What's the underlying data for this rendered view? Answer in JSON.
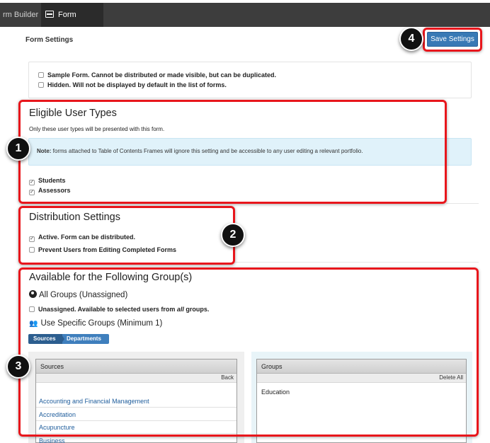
{
  "header": {
    "tab_builder": "rm Builder",
    "tab_settings": "Form Settings"
  },
  "page": {
    "title": "Form Settings",
    "save_label": "Save Settings"
  },
  "form_options": {
    "sample": {
      "label": "Sample Form. Cannot be distributed or made visible, but can be duplicated.",
      "checked": false
    },
    "hidden": {
      "label": "Hidden. Will not be displayed by default in the list of forms.",
      "checked": false
    }
  },
  "eligible": {
    "heading": "Eligible User Types",
    "description": "Only these user types will be presented with this form.",
    "note_label": "Note:",
    "note_text": " forms attached to Table of Contents Frames will ignore this setting and be accessible to any user editing a relevant portfolio.",
    "students": "Students",
    "assessors": "Assessors"
  },
  "distribution": {
    "heading": "Distribution Settings",
    "active_bold": "Active.",
    "active_rest": " Form can be distributed.",
    "prevent": "Prevent Users from Editing Completed Forms"
  },
  "groups": {
    "heading": "Available for the Following Group(s)",
    "all_groups": "All Groups (Unassigned)",
    "unassigned_bold": "Unassigned.",
    "unassigned_pre": " Available to selected users from ",
    "unassigned_em": "all",
    "unassigned_post": " groups.",
    "specific": "Use Specific Groups (Minimum 1)",
    "crumb_sources": "Sources",
    "crumb_departments": "Departments"
  },
  "sources_box": {
    "title": "Sources",
    "back": "Back",
    "items": [
      "Accounting and Financial Management",
      "Accreditation",
      "Acupuncture",
      "Business"
    ]
  },
  "groups_box": {
    "title": "Groups",
    "delete_all": "Delete All",
    "items": [
      "Education"
    ]
  },
  "annotations": [
    "1",
    "2",
    "3",
    "4"
  ],
  "colors": {
    "annotation": "#e8161c",
    "button": "#3879b5",
    "link": "#1f5d9c",
    "note_bg": "#e0f2fa"
  }
}
